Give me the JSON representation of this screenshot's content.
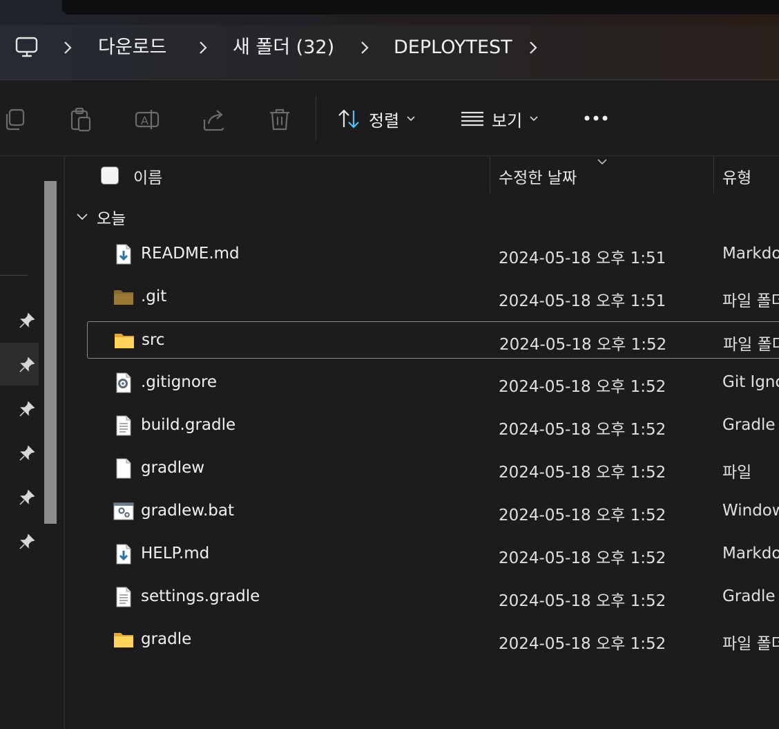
{
  "breadcrumb": {
    "items": [
      {
        "label": "다운로드"
      },
      {
        "label": "새 폴더 (32)"
      },
      {
        "label": "DEPLOYTEST"
      }
    ]
  },
  "toolbar": {
    "sort_label": "정렬",
    "view_label": "보기"
  },
  "columns": {
    "name": "이름",
    "date": "수정한 날짜",
    "type": "유형"
  },
  "group": {
    "label": "오늘"
  },
  "files": [
    {
      "name": "README.md",
      "date": "2024-05-18 오후 1:51",
      "type": "Markdown",
      "icon": "markdown-file-icon"
    },
    {
      "name": ".git",
      "date": "2024-05-18 오후 1:51",
      "type": "파일 폴더",
      "icon": "hidden-folder-icon"
    },
    {
      "name": "src",
      "date": "2024-05-18 오후 1:52",
      "type": "파일 폴더",
      "icon": "folder-icon"
    },
    {
      "name": ".gitignore",
      "date": "2024-05-18 오후 1:52",
      "type": "Git Ignore",
      "icon": "settings-file-icon"
    },
    {
      "name": "build.gradle",
      "date": "2024-05-18 오후 1:52",
      "type": "Gradle",
      "icon": "text-file-icon"
    },
    {
      "name": "gradlew",
      "date": "2024-05-18 오후 1:52",
      "type": "파일",
      "icon": "blank-file-icon"
    },
    {
      "name": "gradlew.bat",
      "date": "2024-05-18 오후 1:52",
      "type": "Windows",
      "icon": "batch-file-icon"
    },
    {
      "name": "HELP.md",
      "date": "2024-05-18 오후 1:52",
      "type": "Markdown",
      "icon": "markdown-file-icon"
    },
    {
      "name": "settings.gradle",
      "date": "2024-05-18 오후 1:52",
      "type": "Gradle",
      "icon": "text-file-icon"
    },
    {
      "name": "gradle",
      "date": "2024-05-18 오후 1:52",
      "type": "파일 폴더",
      "icon": "folder-icon"
    }
  ]
}
